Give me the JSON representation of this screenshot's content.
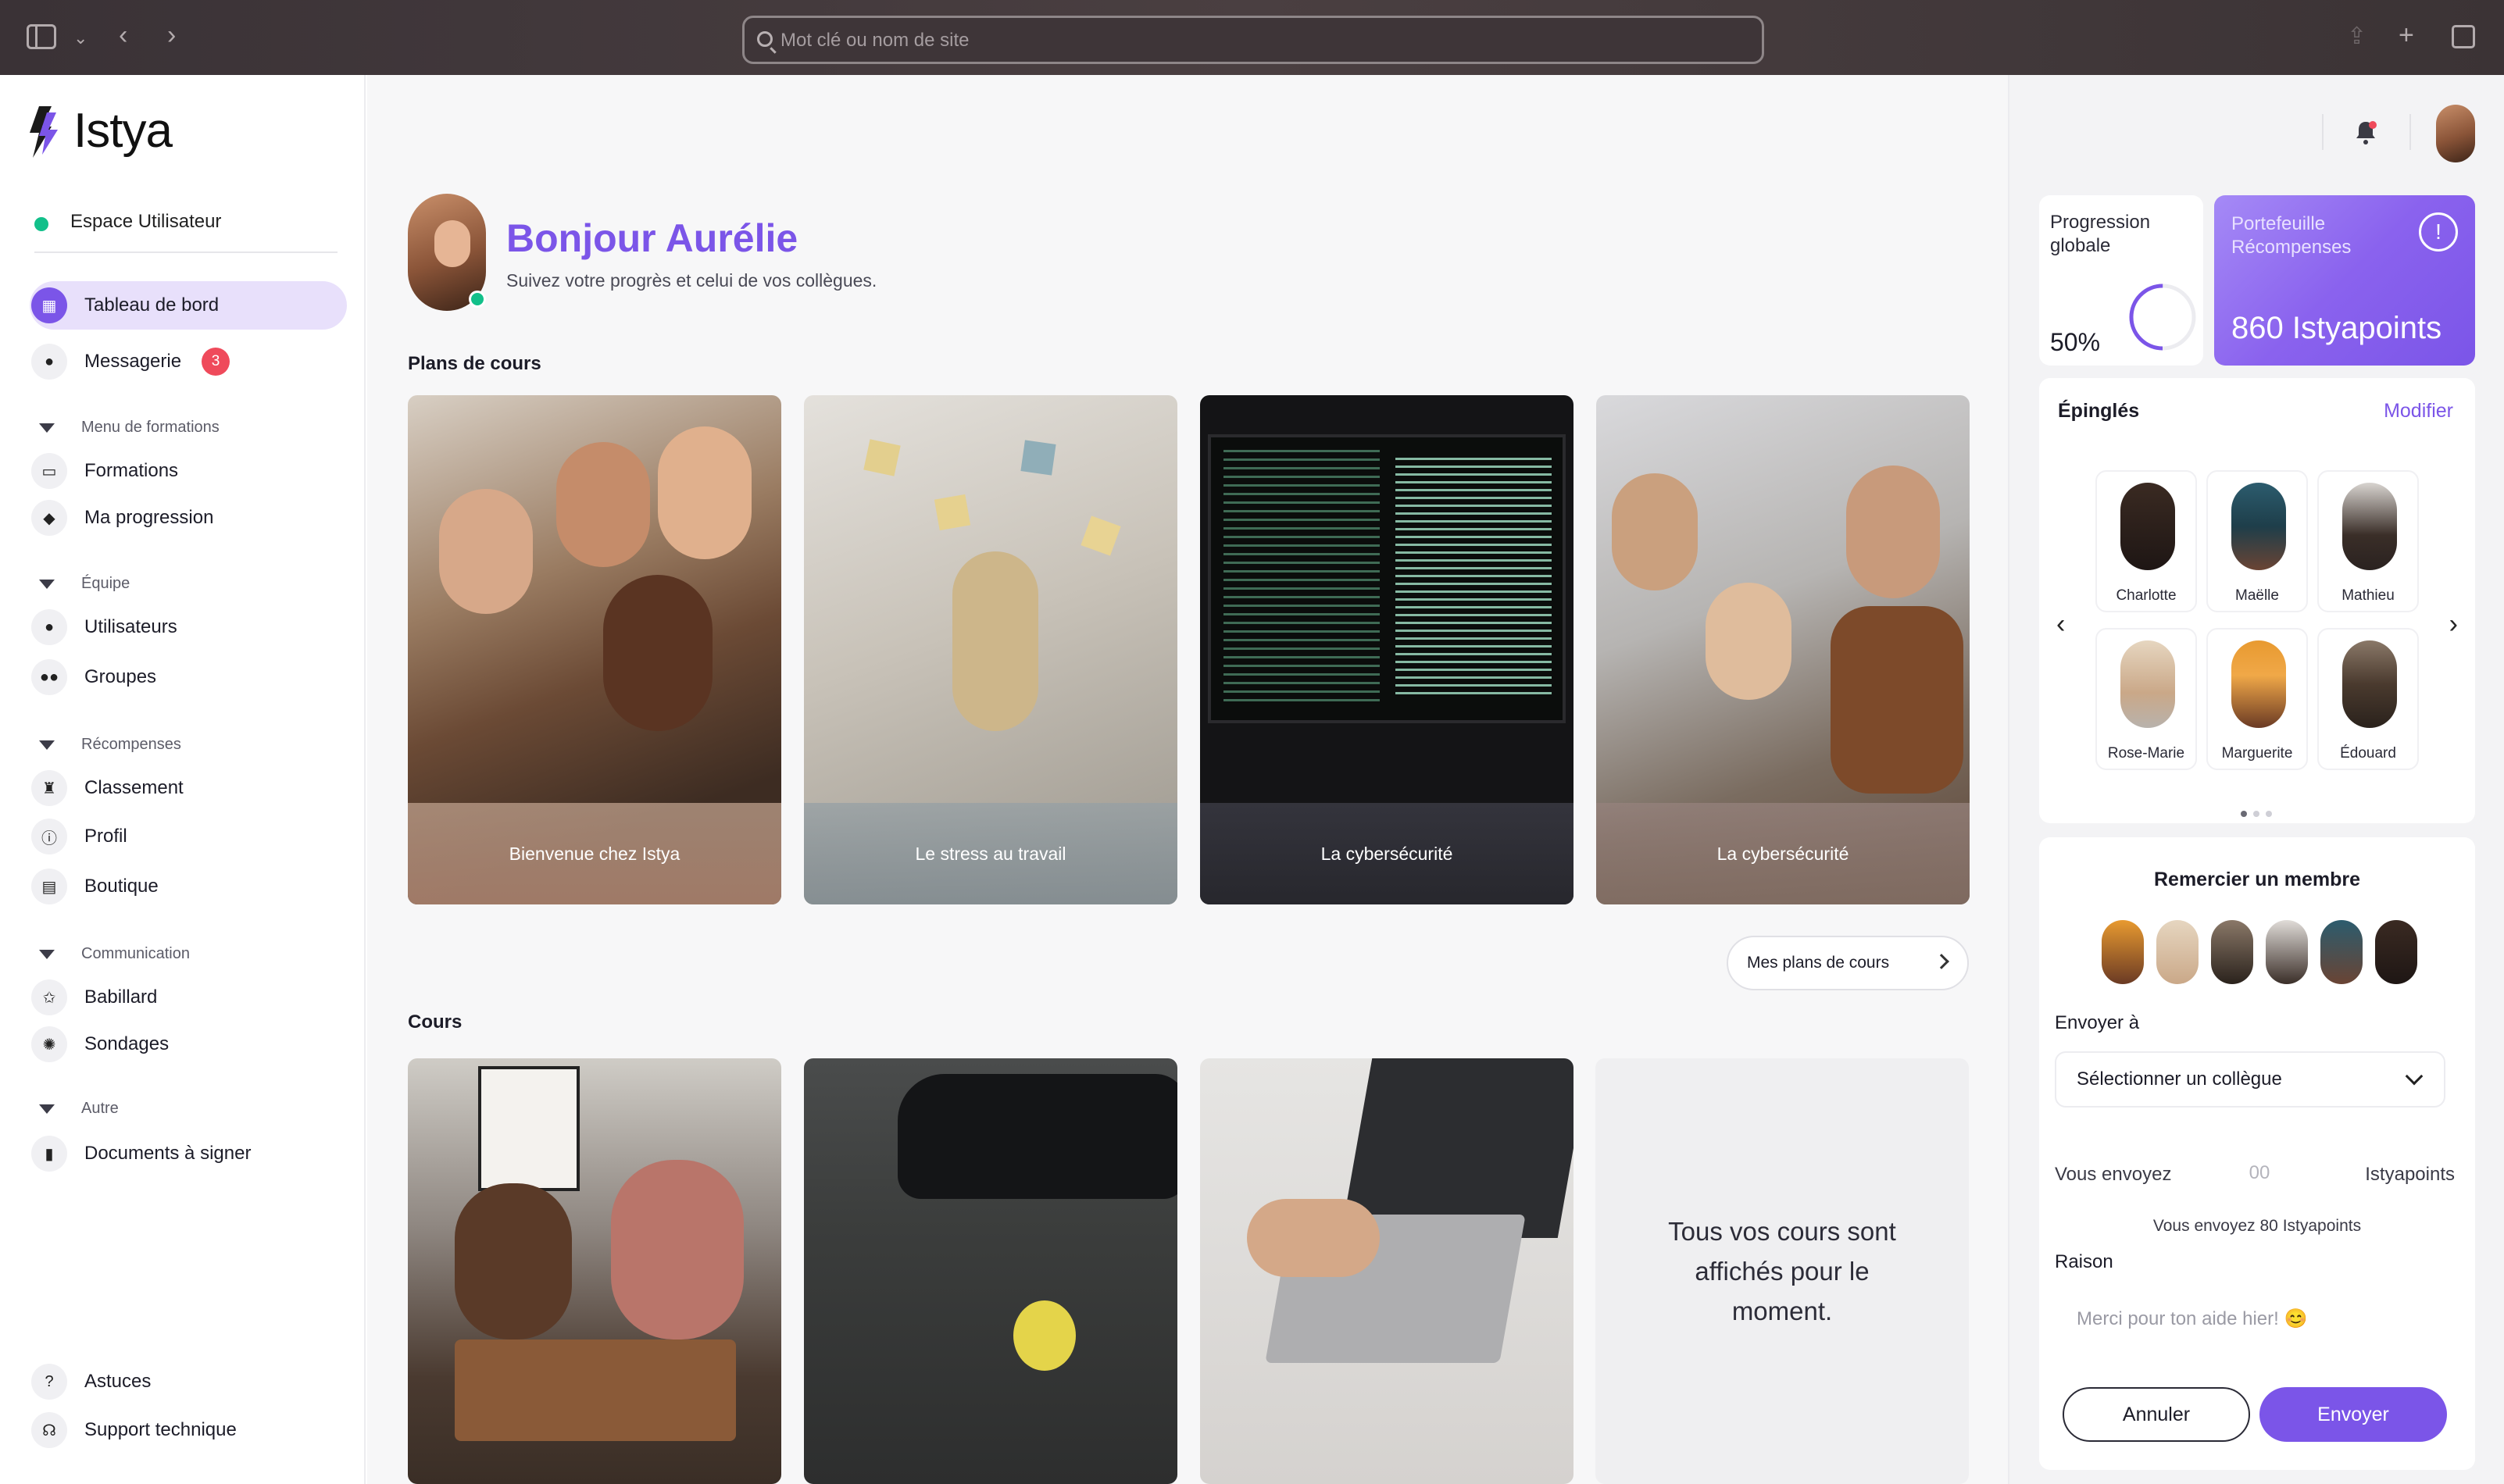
{
  "browser": {
    "address_placeholder": "Mot clé ou nom de site"
  },
  "brand": {
    "name": "Istya",
    "accent": "#7b55e8",
    "online_color": "#12c08a",
    "badge_color": "#ef4a5b"
  },
  "sidebar": {
    "workspace": "Espace Utilisateur",
    "items": [
      {
        "label": "Tableau de bord",
        "icon": "grid-icon",
        "active": true
      },
      {
        "label": "Messagerie",
        "icon": "chat-bubble-icon",
        "badge": "3"
      },
      {
        "label": "Formations",
        "icon": "presentation-icon"
      },
      {
        "label": "Ma progression",
        "icon": "graduation-cap-icon"
      },
      {
        "label": "Utilisateurs",
        "icon": "user-icon"
      },
      {
        "label": "Groupes",
        "icon": "users-group-icon"
      },
      {
        "label": "Classement",
        "icon": "trophy-icon"
      },
      {
        "label": "Profil",
        "icon": "profile-icon"
      },
      {
        "label": "Boutique",
        "icon": "store-icon"
      },
      {
        "label": "Babillard",
        "icon": "pin-icon"
      },
      {
        "label": "Sondages",
        "icon": "lightbulb-icon"
      },
      {
        "label": "Documents à signer",
        "icon": "document-icon"
      }
    ],
    "sections": [
      "Menu de formations",
      "Équipe",
      "Récompenses",
      "Communication",
      "Autre"
    ],
    "footer": [
      {
        "label": "Astuces",
        "icon": "question-icon"
      },
      {
        "label": "Support technique",
        "icon": "headset-icon"
      }
    ]
  },
  "main": {
    "greeting": "Bonjour Aurélie",
    "subtitle": "Suivez votre progrès et celui de vos collègues.",
    "plans_title": "Plans de cours",
    "plans": [
      {
        "title": "Bienvenue chez Istya"
      },
      {
        "title": "Le stress au travail"
      },
      {
        "title": "La cybersécurité"
      },
      {
        "title": "La cybersécurité"
      }
    ],
    "plans_link": "Mes plans de cours",
    "courses_title": "Cours",
    "empty_message": "Tous vos cours sont affichés pour le moment."
  },
  "right": {
    "progress_label": "Progression globale",
    "progress_value": "50%",
    "progress_fraction": 0.5,
    "wallet_label": "Portefeuille Récompenses",
    "wallet_value": "860 Istyapoints",
    "pinned_title": "Épinglés",
    "pinned_edit": "Modifier",
    "pinned": [
      "Charlotte",
      "Maëlle",
      "Mathieu",
      "Rose-Marie",
      "Marguerite",
      "Édouard"
    ],
    "thank_title": "Remercier un membre",
    "send_to_label": "Envoyer à",
    "select_value": "Sélectionner un collègue",
    "you_send_label": "Vous envoyez",
    "amount_placeholder": "00",
    "points_unit": "Istyapoints",
    "summary": "Vous envoyez 80 Istyapoints",
    "reason_label": "Raison",
    "reason_placeholder": "Merci pour ton aide hier! 😊",
    "cancel": "Annuler",
    "send": "Envoyer"
  }
}
